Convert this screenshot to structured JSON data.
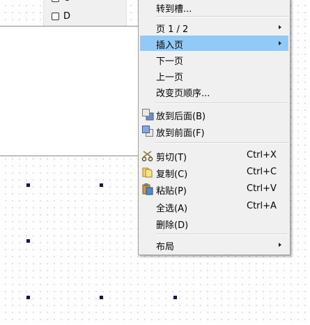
{
  "checkbox_panel": {
    "items": [
      {
        "label": "C",
        "checked": false
      },
      {
        "label": "D",
        "checked": false
      }
    ]
  },
  "context_menu": {
    "items": [
      {
        "label": "转到槽...",
        "shortcut": "",
        "submenu": false,
        "icon": ""
      },
      {
        "label": "页 1 / 2",
        "shortcut": "",
        "submenu": true,
        "icon": ""
      },
      {
        "label": "插入页",
        "shortcut": "",
        "submenu": true,
        "icon": "",
        "highlighted": true
      },
      {
        "label": "下一页",
        "shortcut": "",
        "submenu": false,
        "icon": ""
      },
      {
        "label": "上一页",
        "shortcut": "",
        "submenu": false,
        "icon": ""
      },
      {
        "label": "改变页顺序...",
        "shortcut": "",
        "submenu": false,
        "icon": ""
      },
      {
        "label": "放到后面(B)",
        "shortcut": "",
        "submenu": false,
        "icon": "send-to-back-icon"
      },
      {
        "label": "放到前面(F)",
        "shortcut": "",
        "submenu": false,
        "icon": "bring-to-front-icon"
      },
      {
        "label": "剪切(T)",
        "shortcut": "Ctrl+X",
        "submenu": false,
        "icon": "scissors-icon"
      },
      {
        "label": "复制(C)",
        "shortcut": "Ctrl+C",
        "submenu": false,
        "icon": "copy-icon"
      },
      {
        "label": "粘贴(P)",
        "shortcut": "Ctrl+V",
        "submenu": false,
        "icon": "paste-icon"
      },
      {
        "label": "全选(A)",
        "shortcut": "Ctrl+A",
        "submenu": false,
        "icon": ""
      },
      {
        "label": "删除(D)",
        "shortcut": "",
        "submenu": false,
        "icon": ""
      },
      {
        "label": "布局",
        "shortcut": "",
        "submenu": true,
        "icon": ""
      }
    ]
  },
  "colors": {
    "highlight": "#91c9f7",
    "menu_background": "#f0f0f0",
    "selection_handle": "#14145a"
  }
}
